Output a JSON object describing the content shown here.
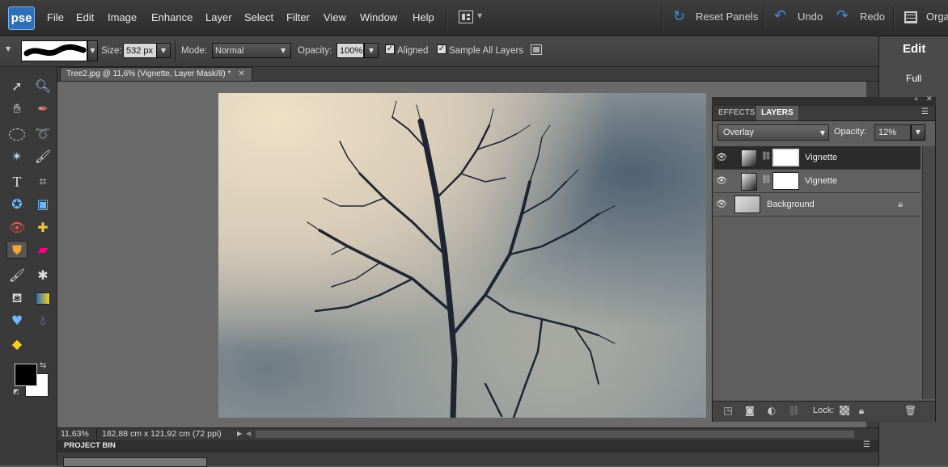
{
  "app": {
    "logo_text": "pse"
  },
  "menu": [
    "File",
    "Edit",
    "Image",
    "Enhance",
    "Layer",
    "Select",
    "Filter",
    "View",
    "Window",
    "Help"
  ],
  "topbar": {
    "reset_panels": "Reset Panels",
    "undo": "Undo",
    "redo": "Redo",
    "organizer": "Orga"
  },
  "options": {
    "size_label": "Size:",
    "size_value": "532 px",
    "mode_label": "Mode:",
    "mode_value": "Normal",
    "opacity_label": "Opacity:",
    "opacity_value": "100%",
    "aligned_label": "Aligned",
    "aligned_checked": true,
    "sample_all_label": "Sample All Layers",
    "sample_all_checked": true
  },
  "edit_panel": {
    "title": "Edit",
    "mode": "Full"
  },
  "document": {
    "tab_title": "Tree2.jpg @ 11,6% (Vignette, Layer Mask/8) *"
  },
  "status": {
    "zoom": "11,63%",
    "dimensions": "182,88 cm x 121,92 cm (72 ppi)"
  },
  "project_bin": {
    "title": "PROJECT BIN"
  },
  "layers_panel": {
    "tabs": [
      "EFFECTS",
      "LAYERS"
    ],
    "active_tab": "LAYERS",
    "blend_mode": "Overlay",
    "opacity_label": "Opacity:",
    "opacity_value": "12%",
    "layers": [
      {
        "name": "Vignette",
        "selected": true
      },
      {
        "name": "Vignette",
        "selected": false
      },
      {
        "name": "Background",
        "selected": false,
        "locked": true
      }
    ],
    "lock_label": "Lock:"
  },
  "colors": {
    "foreground": "#000000",
    "background": "#ffffff",
    "accent": "#2f6fb8"
  }
}
